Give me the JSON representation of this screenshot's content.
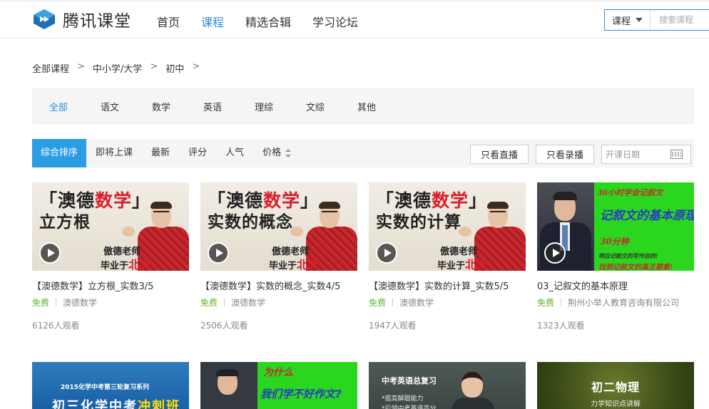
{
  "header": {
    "logo_text": "腾讯课堂",
    "nav": [
      {
        "label": "首页",
        "active": false
      },
      {
        "label": "课程",
        "active": true
      },
      {
        "label": "精选合辑",
        "active": false
      },
      {
        "label": "学习论坛",
        "active": false
      }
    ],
    "search": {
      "type_label": "课程",
      "placeholder": "搜索课程"
    }
  },
  "breadcrumb": [
    "全部课程",
    "中小学/大学",
    "初中"
  ],
  "breadcrumb_sep": ">",
  "categories": [
    {
      "label": "全部",
      "active": true
    },
    {
      "label": "语文"
    },
    {
      "label": "数学"
    },
    {
      "label": "英语"
    },
    {
      "label": "理综"
    },
    {
      "label": "文综"
    },
    {
      "label": "其他"
    }
  ],
  "sort": {
    "items": [
      "综合排序",
      "即将上课",
      "最新",
      "评分",
      "人气",
      "价格"
    ],
    "active": "综合排序",
    "live_only": "只看直播",
    "recorded_only": "只看录播",
    "date_placeholder": "开课日期"
  },
  "colors": {
    "accent": "#2f8dd8",
    "free": "#5fb52a",
    "sort_active": "#2c9de4"
  },
  "courses": [
    {
      "title": "【澳德数学】立方根_实数3/5",
      "price": "免费",
      "provider": "澳德数学",
      "viewers": "6126人观看",
      "thumb": {
        "line1_a": "「澳德",
        "line1_b": "数学",
        "line1_c": "」",
        "line2": "立方根",
        "teacher": "傲德老师",
        "school_a": "毕业于",
        "school_b": "北大"
      }
    },
    {
      "title": "【澳德数学】实数的概念_实数4/5",
      "price": "免费",
      "provider": "澳德数学",
      "viewers": "2506人观看",
      "thumb": {
        "line1_a": "「澳德",
        "line1_b": "数学",
        "line1_c": "」",
        "line2": "实数的概念",
        "teacher": "傲德老师",
        "school_a": "毕业于",
        "school_b": "北大"
      }
    },
    {
      "title": "【澳德数学】实数的计算_实数5/5",
      "price": "免费",
      "provider": "澳德数学",
      "viewers": "1947人观看",
      "thumb": {
        "line1_a": "「澳德",
        "line1_b": "数学",
        "line1_c": "」",
        "line2": "实数的计算",
        "teacher": "傲德老师",
        "school_a": "毕业于",
        "school_b": "北大"
      }
    },
    {
      "title": "03_记叙文的基本原理",
      "price": "免费",
      "provider": "荆州小举人教育咨询有限公司",
      "viewers": "1323人观看",
      "thumb": {
        "line1": "36小时学会记叙文",
        "line2": "记叙文的基本原理",
        "line3": "30分钟",
        "line4": "明白记叙文的写作目的!",
        "line5": "找到记叙文的真正要素!"
      }
    }
  ],
  "second_row": {
    "chem": {
      "line1": "2015化学中考第三轮复习系列",
      "line2_a": "初三化学中考",
      "line2_b": "冲刺班"
    },
    "why": {
      "line1": "为什么",
      "line2": "我们学不好作文?"
    },
    "eng": {
      "line1": "中考英语总复习",
      "line2": "*提高解题能力",
      "line3": "*引领中考英语高分"
    },
    "phys": {
      "line1": "初二物理",
      "line2": "力学知识点讲解"
    }
  }
}
